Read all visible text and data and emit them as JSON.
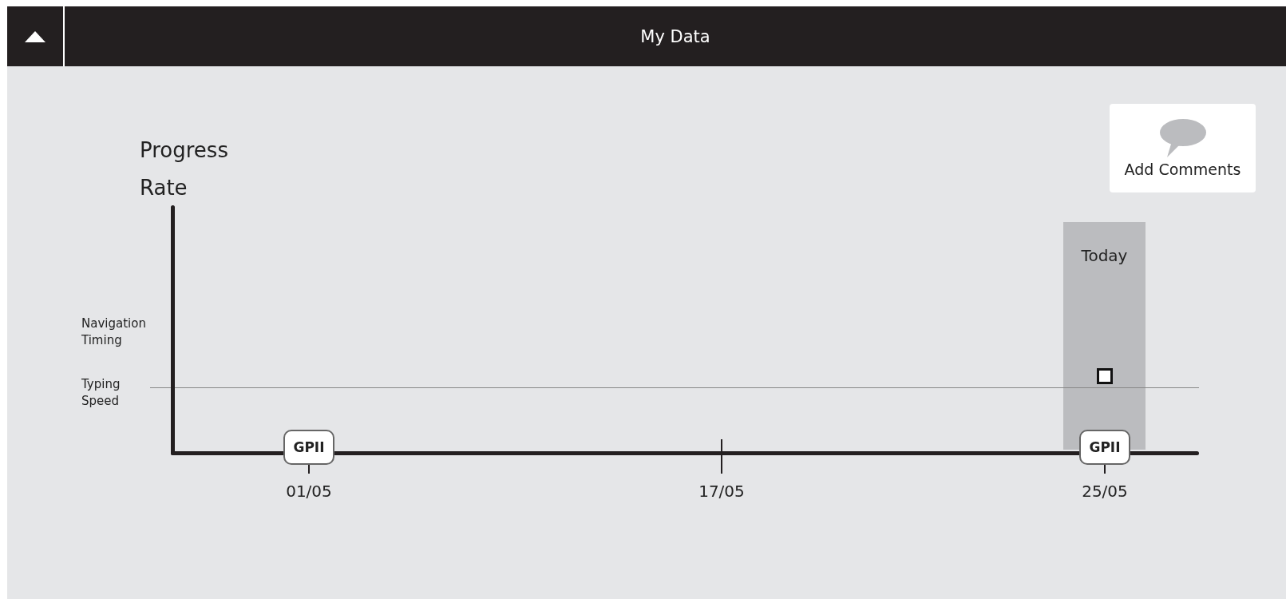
{
  "header": {
    "title": "My Data"
  },
  "add_comments": {
    "label": "Add Comments"
  },
  "chart": {
    "y_title": "Progress Rate",
    "rows": [
      {
        "label": "Navigation Timing"
      },
      {
        "label": "Typing Speed"
      }
    ],
    "dates": [
      {
        "label": "01/05",
        "kind": "marker",
        "marker": "GPII",
        "today": false
      },
      {
        "label": "17/05",
        "kind": "tick",
        "today": false
      },
      {
        "label": "25/05",
        "kind": "marker",
        "marker": "GPII",
        "today": true,
        "point": {
          "filled": false
        }
      }
    ],
    "today": {
      "label": "Today"
    }
  }
}
